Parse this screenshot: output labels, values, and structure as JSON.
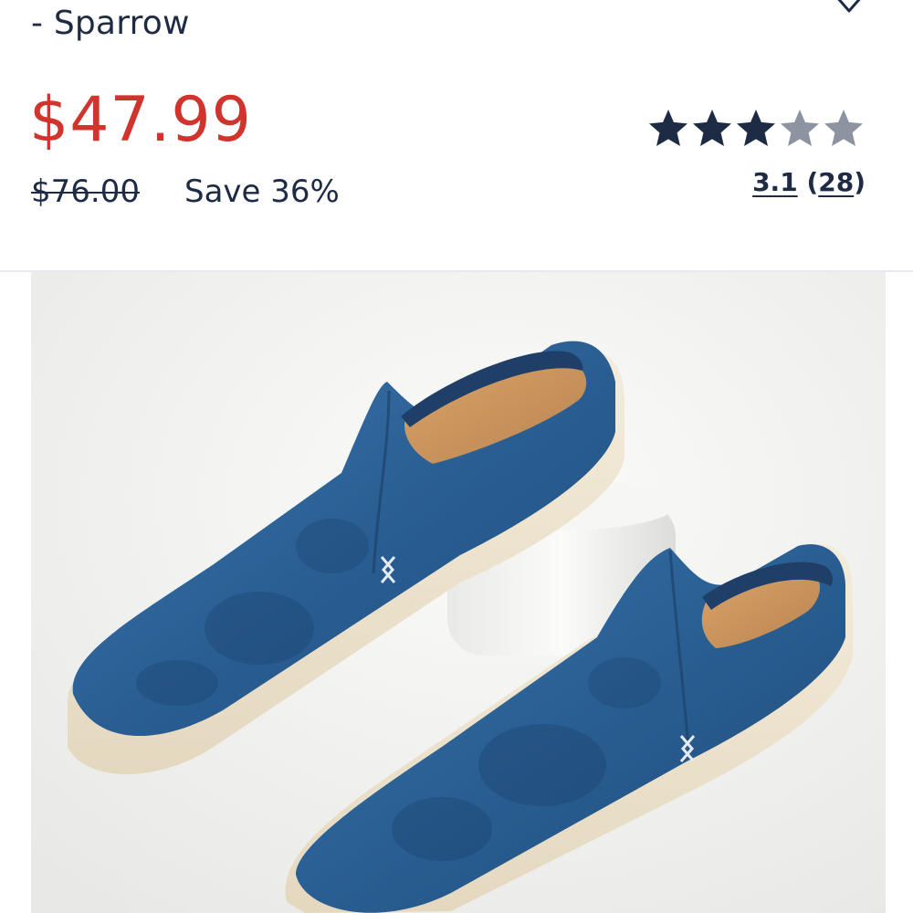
{
  "product": {
    "title_tail": "- Sparrow",
    "price_current": "$47.99",
    "price_original": "$76.00",
    "savings": "Save 36%",
    "image_icon": "denim-slip-on-mule-shoes-image"
  },
  "rating": {
    "stars_value": 3.1,
    "stars_max": 5,
    "average": "3.1",
    "count": "28",
    "open_paren": "(",
    "close_paren": ")"
  },
  "icons": {
    "wishlist": "heart-icon",
    "star": "star-icon"
  },
  "colors": {
    "sale_price": "#d0342c",
    "text_primary": "#1d2b45",
    "star_filled": "#1d2b45",
    "star_empty": "#8d93a0",
    "divider": "#e7e9ee"
  }
}
